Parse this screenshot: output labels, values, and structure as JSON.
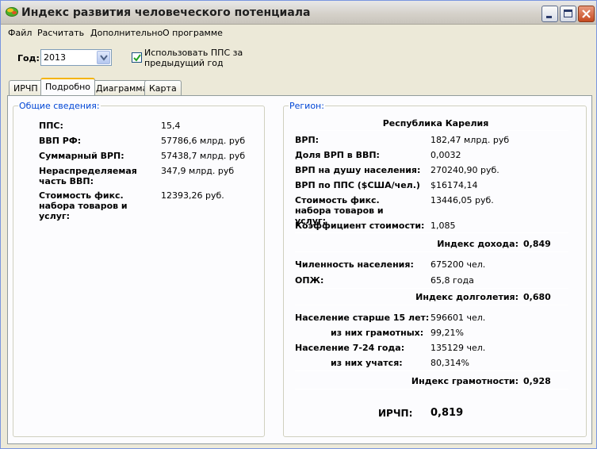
{
  "window": {
    "title": "Индекс развития человеческого потенциала"
  },
  "menu": [
    {
      "label": "Файл"
    },
    {
      "label": "Расчитать"
    },
    {
      "label": "Дополнительно"
    },
    {
      "label": "О программе"
    }
  ],
  "toolbar": {
    "year_label": "Год:",
    "year_value": "2013",
    "use_ppp_label": "Использовать ППС за предыдущий год",
    "use_ppp_checked": true
  },
  "tabs": [
    {
      "label": "ИРЧП"
    },
    {
      "label": "Подробно",
      "active": true
    },
    {
      "label": "Диаграмма"
    },
    {
      "label": "Карта"
    }
  ],
  "general": {
    "title": "Общие сведения:",
    "rows": [
      {
        "label": "ППС:",
        "value": "15,4"
      },
      {
        "label": "ВВП РФ:",
        "value": "57786,6 млрд. руб"
      },
      {
        "label": "Суммарный ВРП:",
        "value": "57438,7 млрд. руб"
      },
      {
        "label": "Нераспределяемая часть ВВП:",
        "value": "347,9 млрд. руб"
      },
      {
        "label": "Стоимость фикс. набора товаров и услуг:",
        "value": "12393,26 руб."
      }
    ]
  },
  "region": {
    "title": "Регион:",
    "name": "Республика Карелия",
    "income_rows": [
      {
        "label": "ВРП:",
        "value": "182,47 млрд. руб"
      },
      {
        "label": "Доля ВРП в ВВП:",
        "value": "0,0032"
      },
      {
        "label": "ВРП на душу населения:",
        "value": "270240,90 руб."
      },
      {
        "label": "ВРП по ППС ($США/чел.)",
        "value": "$16174,14"
      },
      {
        "label": "Стоимость фикс. набора товаров и услуг:",
        "value": "13446,05 руб."
      },
      {
        "label": "Коэффициент стоимости:",
        "value": "1,085"
      }
    ],
    "income_index_label": "Индекс дохода:",
    "income_index_value": "0,849",
    "longevity_rows": [
      {
        "label": "Чиленность населения:",
        "value": "675200 чел."
      },
      {
        "label": "ОПЖ:",
        "value": "65,8 года"
      }
    ],
    "longevity_index_label": "Индекс долголетия:",
    "longevity_index_value": "0,680",
    "literacy_rows": [
      {
        "label": "Население старше 15 лет:",
        "value": "596601 чел."
      },
      {
        "label": "из них грамотных:",
        "value": "99,21%"
      },
      {
        "label": "Население 7-24 года:",
        "value": "135129 чел."
      },
      {
        "label": "из них учатся:",
        "value": "80,314%"
      }
    ],
    "literacy_index_label": "Индекс грамотности:",
    "literacy_index_value": "0,928",
    "hdi_label": "ИРЧП:",
    "hdi_value": "0,819"
  }
}
